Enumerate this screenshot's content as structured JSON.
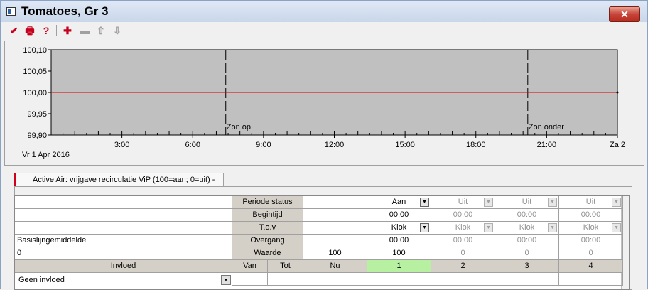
{
  "window": {
    "title": "Tomatoes, Gr 3",
    "close_glyph": "✕"
  },
  "toolbar": {
    "items": [
      {
        "name": "confirm-icon",
        "glyph": "✔",
        "color": "#c4001c"
      },
      {
        "name": "print-icon",
        "glyph": "🖶",
        "color": "#c4001c"
      },
      {
        "name": "help-icon",
        "glyph": "?",
        "color": "#c4001c"
      },
      {
        "name": "add-icon",
        "glyph": "✚",
        "color": "#c4001c"
      },
      {
        "name": "remove-icon",
        "glyph": "▬",
        "color": "#a0a0a0"
      },
      {
        "name": "move-up-icon",
        "glyph": "⇧",
        "color": "#a0a0a0"
      },
      {
        "name": "move-down-icon",
        "glyph": "⇩",
        "color": "#a0a0a0"
      }
    ]
  },
  "chart_data": {
    "type": "line",
    "y_ticks": [
      "100,10",
      "100,05",
      "100,00",
      "99,95",
      "99,90"
    ],
    "ylim": [
      99.9,
      100.1
    ],
    "x_ticks": [
      "3:00",
      "6:00",
      "9:00",
      "12:00",
      "15:00",
      "18:00",
      "21:00",
      "Za 2"
    ],
    "x_tick_hours": [
      3,
      6,
      9,
      12,
      15,
      18,
      21,
      24
    ],
    "xlim_hours": [
      0,
      24
    ],
    "series": [
      {
        "x_hours": [
          0,
          24
        ],
        "values": [
          100.0,
          100.0
        ],
        "color": "#e00000"
      }
    ],
    "annotations": [
      {
        "label": "Zon op",
        "x_hours": 7.4
      },
      {
        "label": "Zon onder",
        "x_hours": 20.2
      }
    ],
    "date_label": "Vr  1 Apr 2016"
  },
  "tab": {
    "label": "Active Air: vrijgave recirculatie ViP (100=aan; 0=uit) -"
  },
  "grid": {
    "left_rows": [
      "",
      "",
      "",
      "Basislijngemiddelde",
      "0"
    ],
    "row_labels": [
      "Periode status",
      "Begintijd",
      "T.o.v",
      "Overgang",
      "Waarde"
    ],
    "nu_values": [
      "",
      "",
      "",
      "",
      "100"
    ],
    "periods": [
      {
        "status": "Aan",
        "begin": "00:00",
        "tov": "Klok",
        "overgang": "00:00",
        "waarde": "100",
        "active": true
      },
      {
        "status": "Uit",
        "begin": "00:00",
        "tov": "Klok",
        "overgang": "00:00",
        "waarde": "0",
        "active": false
      },
      {
        "status": "Uit",
        "begin": "00:00",
        "tov": "Klok",
        "overgang": "00:00",
        "waarde": "0",
        "active": false
      },
      {
        "status": "Uit",
        "begin": "00:00",
        "tov": "Klok",
        "overgang": "00:00",
        "waarde": "0",
        "active": false
      }
    ],
    "header": {
      "invloed": "Invloed",
      "van": "Van",
      "tot": "Tot",
      "nu": "Nu",
      "period_numbers": [
        "1",
        "2",
        "3",
        "4"
      ]
    },
    "invloed_value": "Geen invloed",
    "dropdown_glyph": "▼",
    "active_color": "#b6f0a0"
  }
}
